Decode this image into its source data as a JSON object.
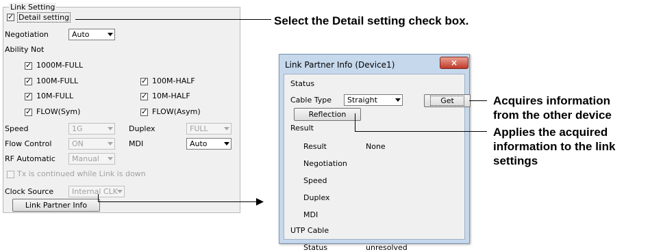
{
  "link_setting": {
    "group_title": "Link Setting",
    "detail_setting_label": "Detail setting",
    "detail_setting_checked": true,
    "negotiation_label": "Negotiation",
    "negotiation_value": "Auto",
    "ability_label": "Ability Not",
    "abilities": [
      {
        "label": "1000M-FULL",
        "checked": true
      },
      {
        "label": "100M-FULL",
        "checked": true
      },
      {
        "label": "100M-HALF",
        "checked": true
      },
      {
        "label": "10M-FULL",
        "checked": true
      },
      {
        "label": "10M-HALF",
        "checked": true
      },
      {
        "label": "FLOW(Sym)",
        "checked": true
      },
      {
        "label": "FLOW(Asym)",
        "checked": true
      }
    ],
    "speed_label": "Speed",
    "speed_value": "1G",
    "duplex_label": "Duplex",
    "duplex_value": "FULL",
    "flow_control_label": "Flow Control",
    "flow_control_value": "ON",
    "mdi_label": "MDI",
    "mdi_value": "Auto",
    "rf_label": "RF Automatic",
    "rf_value": "Manual",
    "tx_label": "Tx is continued while Link is down",
    "clock_label": "Clock Source",
    "clock_value": "Internal CLK",
    "link_partner_button": "Link Partner Info"
  },
  "dialog": {
    "title": "Link Partner Info (Device1)",
    "close_glyph": "×",
    "status_label": "Status",
    "cable_type_label": "Cable Type",
    "cable_type_value": "Straight",
    "get_button": "Get",
    "reflection_button": "Reflection",
    "result_section": "Result",
    "result_label": "Result",
    "result_value": "None",
    "negotiation_label": "Negotiation",
    "speed_label": "Speed",
    "duplex_label": "Duplex",
    "mdi_label": "MDI",
    "utp_section": "UTP Cable",
    "utp_status_label": "Status",
    "utp_status_value": "unresolved"
  },
  "annotations": {
    "detail_note": "Select the Detail setting check box.",
    "get_note_1": "Acquires information",
    "get_note_2": "from the other device",
    "reflect_note_1": "Applies the acquired",
    "reflect_note_2": "information to the link",
    "reflect_note_3": "settings"
  },
  "icons": {
    "checkbox": "checkbox-icon",
    "dropdown": "chevron-down-icon",
    "close": "close-icon",
    "arrow": "arrow-right-icon"
  }
}
